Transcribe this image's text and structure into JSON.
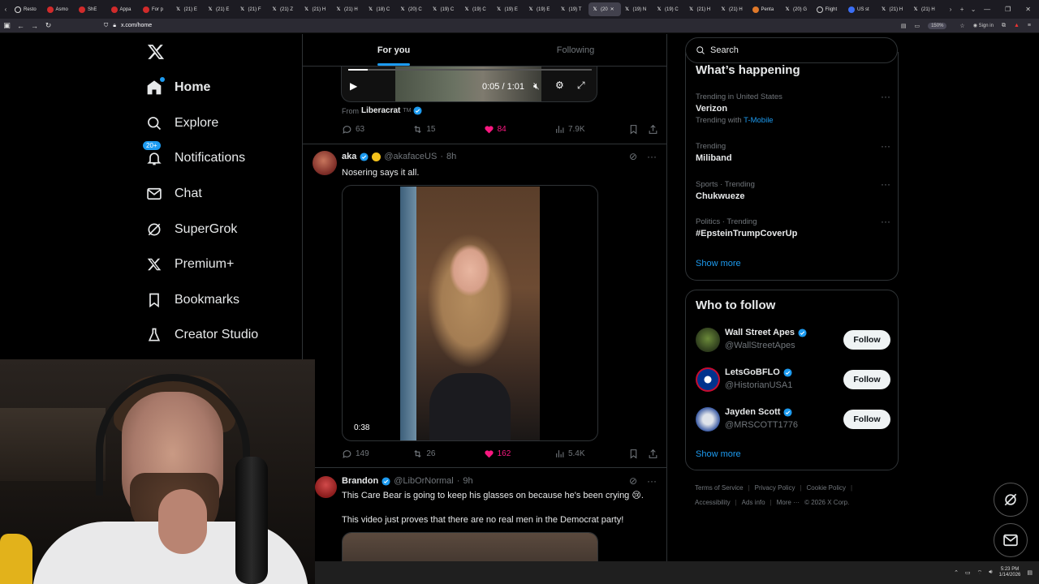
{
  "browser": {
    "tabs": [
      {
        "label": "Resto",
        "icon": "circle"
      },
      {
        "label": "Asmo",
        "icon": "red"
      },
      {
        "label": "ShE",
        "icon": "red"
      },
      {
        "label": "Appa",
        "icon": "red"
      },
      {
        "label": "For p",
        "icon": "red"
      },
      {
        "label": "(21) E",
        "icon": "x"
      },
      {
        "label": "(21) E",
        "icon": "x"
      },
      {
        "label": "(21) F",
        "icon": "x"
      },
      {
        "label": "(21) Z",
        "icon": "x"
      },
      {
        "label": "(21) H",
        "icon": "x"
      },
      {
        "label": "(21) H",
        "icon": "x"
      },
      {
        "label": "(18) C",
        "icon": "x"
      },
      {
        "label": "(20) C",
        "icon": "x"
      },
      {
        "label": "(19) C",
        "icon": "x"
      },
      {
        "label": "(19) C",
        "icon": "x"
      },
      {
        "label": "(19) E",
        "icon": "x"
      },
      {
        "label": "(19) E",
        "icon": "x"
      },
      {
        "label": "(19) T",
        "icon": "x"
      },
      {
        "label": "(20",
        "icon": "x",
        "active": true
      },
      {
        "label": "(19) N",
        "icon": "x"
      },
      {
        "label": "(19) C",
        "icon": "x"
      },
      {
        "label": "(21) H",
        "icon": "x"
      },
      {
        "label": "(21) H",
        "icon": "x"
      },
      {
        "label": "Penta",
        "icon": "orange"
      },
      {
        "label": "(20) G",
        "icon": "x"
      },
      {
        "label": "Flight",
        "icon": "globe"
      },
      {
        "label": "US st",
        "icon": "blue"
      },
      {
        "label": "(21) H",
        "icon": "x"
      },
      {
        "label": "(21) H",
        "icon": "x"
      }
    ],
    "url": "x.com/home",
    "zoom": "150%",
    "signin": "Sign in"
  },
  "nav": {
    "items": [
      {
        "label": "Home",
        "icon": "home-icon"
      },
      {
        "label": "Explore",
        "icon": "search-icon"
      },
      {
        "label": "Notifications",
        "icon": "bell-icon",
        "badge": "20+"
      },
      {
        "label": "Chat",
        "icon": "mail-icon"
      },
      {
        "label": "SuperGrok",
        "icon": "grok-icon"
      },
      {
        "label": "Premium+",
        "icon": "x-icon"
      },
      {
        "label": "Bookmarks",
        "icon": "bookmark-icon"
      },
      {
        "label": "Creator Studio",
        "icon": "flask-icon"
      }
    ]
  },
  "feed": {
    "tabs": {
      "for_you": "For you",
      "following": "Following"
    },
    "tweet1": {
      "video_time": "0:05 / 1:01",
      "from_label": "From",
      "from_name": "Liberacrat",
      "from_suffix": "TM",
      "replies": "63",
      "reposts": "15",
      "likes": "84",
      "views": "7.9K"
    },
    "tweet2": {
      "name": "aka",
      "handle": "@akafaceUS",
      "sep": "·",
      "time": "8h",
      "text": "Nosering says it all.",
      "duration": "0:38",
      "replies": "149",
      "reposts": "26",
      "likes": "162",
      "views": "5.4K"
    },
    "tweet3": {
      "name": "Brandon",
      "handle": "@LibOrNormal",
      "sep": "·",
      "time": "9h",
      "text": "This Care Bear is going to keep his glasses on because he's been crying 😢.",
      "text2": "This video just proves that there are no real men in the Democrat party!"
    }
  },
  "sidebar": {
    "search_placeholder": "Search",
    "happening_title": "What’s happening",
    "trends": [
      {
        "meta": "Trending in United States",
        "topic": "Verizon",
        "with_label": "Trending with",
        "with_link": "T-Mobile"
      },
      {
        "meta": "Trending",
        "topic": "Miliband"
      },
      {
        "meta": "Sports · Trending",
        "topic": "Chukwueze"
      },
      {
        "meta": "Politics · Trending",
        "topic": "#EpsteinTrumpCoverUp"
      }
    ],
    "show_more": "Show more",
    "who_title": "Who to follow",
    "follow": [
      {
        "name": "Wall Street Apes",
        "handle": "@WallStreetApes",
        "button": "Follow"
      },
      {
        "name": "LetsGoBFLO",
        "handle": "@HistorianUSA1",
        "button": "Follow"
      },
      {
        "name": "Jayden Scott",
        "handle": "@MRSCOTT1776",
        "button": "Follow"
      }
    ],
    "show_more2": "Show more",
    "footer": [
      "Terms of Service",
      "Privacy Policy",
      "Cookie Policy",
      "Accessibility",
      "Ads info",
      "More ···",
      "© 2026 X Corp."
    ]
  },
  "taskbar": {
    "time": "5:23 PM",
    "date": "1/14/2026"
  },
  "colors": {
    "accent": "#1d9bf0",
    "like": "#f91880",
    "border": "#2f3336",
    "muted": "#71767b"
  }
}
